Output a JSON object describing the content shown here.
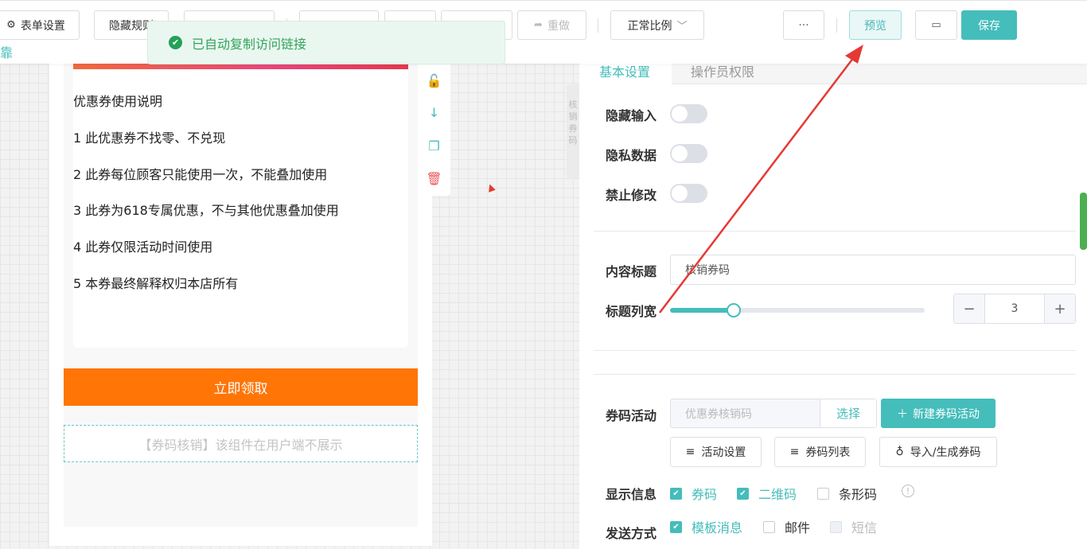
{
  "toolbar": {
    "form_settings": "表单设置",
    "hide_rules": "隐藏规则",
    "redo": "重做",
    "zoom": "正常比例",
    "more": "···",
    "preview": "预览",
    "save": "保存"
  },
  "side_link": "靠",
  "toast": {
    "message": "已自动复制访问链接"
  },
  "coupon": {
    "heading": "优惠券使用说明",
    "rules": [
      "1  此优惠券不找零、不兑现",
      "2  此券每位顾客只能使用一次，不能叠加使用",
      "3  此券为618专属优惠，不与其他优惠叠加使用",
      "4  此券仅限活动时间使用",
      "5  本券最终解释权归本店所有"
    ],
    "claim_button": "立即领取",
    "verify_hint": "【券码核销】该组件在用户端不展示"
  },
  "side_tab_text": "核销券码",
  "panel": {
    "tabs": [
      "基本设置",
      "操作员权限"
    ],
    "hide_input": "隐藏输入",
    "private_data": "隐私数据",
    "no_edit": "禁止修改",
    "content_title_label": "内容标题",
    "content_title_value": "核销券码",
    "title_width_label": "标题列宽",
    "title_width_value": "3",
    "title_width_fraction": 0.25,
    "code_activity_label": "券码活动",
    "code_activity_placeholder": "优惠券核销码",
    "select_button": "选择",
    "new_activity_button": "新建券码活动",
    "activity_settings": "活动设置",
    "code_list": "券码列表",
    "import_codes": "导入/生成券码",
    "display_info_label": "显示信息",
    "display_options": [
      {
        "label": "券码",
        "checked": true
      },
      {
        "label": "二维码",
        "checked": true
      },
      {
        "label": "条形码",
        "checked": false
      }
    ],
    "send_method_label": "发送方式",
    "send_options": [
      {
        "label": "模板消息",
        "checked": true
      },
      {
        "label": "邮件",
        "checked": false
      },
      {
        "label": "短信",
        "checked": false,
        "disabled": true
      }
    ]
  },
  "colors": {
    "accent": "#44bdbb",
    "claim": "#ff7506",
    "toast_green": "#24a159",
    "arrow": "#e53935"
  }
}
